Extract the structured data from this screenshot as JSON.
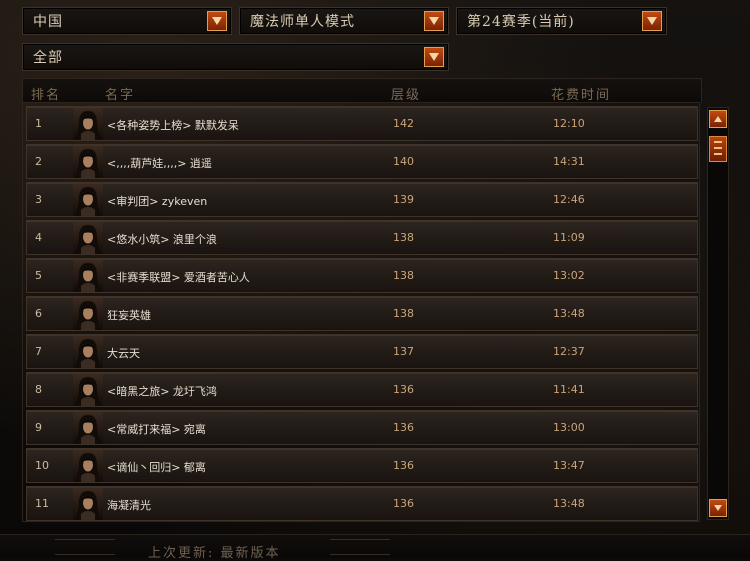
{
  "filters": {
    "region": "中国",
    "mode": "魔法师单人模式",
    "season": "第24赛季(当前)",
    "category": "全部"
  },
  "columns": {
    "rank": "排名",
    "name": "名字",
    "level": "层级",
    "time": "花费时间"
  },
  "rows": [
    {
      "rank": "1",
      "name": "<各种姿势上榜> 默默发呆",
      "level": "142",
      "time": "12:10"
    },
    {
      "rank": "2",
      "name": "<,,,,葫芦娃,,,,> 逍遥",
      "level": "140",
      "time": "14:31"
    },
    {
      "rank": "3",
      "name": "<审判团> zykeven",
      "level": "139",
      "time": "12:46"
    },
    {
      "rank": "4",
      "name": "<悠水小筑> 浪里个浪",
      "level": "138",
      "time": "11:09"
    },
    {
      "rank": "5",
      "name": "<非赛季联盟> 爱酒者苦心人",
      "level": "138",
      "time": "13:02"
    },
    {
      "rank": "6",
      "name": "狂妄英雄",
      "level": "138",
      "time": "13:48"
    },
    {
      "rank": "7",
      "name": "大云天",
      "level": "137",
      "time": "12:37"
    },
    {
      "rank": "8",
      "name": "<暗黑之旅> 龙圩飞鸿",
      "level": "136",
      "time": "11:41"
    },
    {
      "rank": "9",
      "name": "<常威打来福> 宛离",
      "level": "136",
      "time": "13:00"
    },
    {
      "rank": "10",
      "name": "<谪仙丶回归> 郁离",
      "level": "136",
      "time": "13:47"
    },
    {
      "rank": "11",
      "name": "海凝清光",
      "level": "136",
      "time": "13:48"
    }
  ],
  "footer": {
    "last_update": "上次更新: 最新版本"
  },
  "colors": {
    "accent": "#c24a10",
    "accent_border": "#e0a050",
    "row_bg": "#2d2520"
  },
  "icons": {
    "dropdown": "chevron-down-icon",
    "scroll_up": "arrow-up-icon",
    "scroll_down": "arrow-down-icon",
    "portrait": "hero-portrait-icon"
  }
}
